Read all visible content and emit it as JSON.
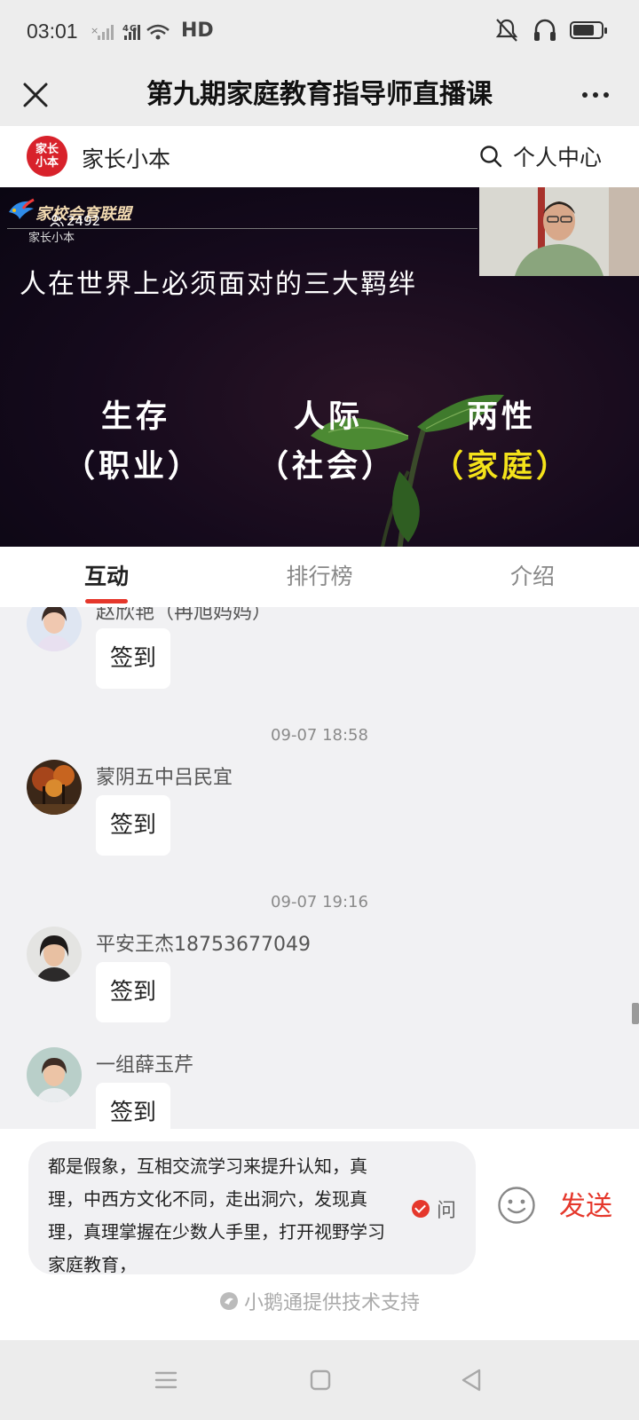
{
  "status_bar": {
    "time": "03:01",
    "network": "4G",
    "wifi_label": "HD",
    "battery_level": 0.75
  },
  "title_bar": {
    "title": "第九期家庭教育指导师直播课"
  },
  "shop": {
    "logo_text": "家长小本",
    "name": "家长小本",
    "personal_center": "个人中心"
  },
  "video": {
    "brand": "家校会育联盟",
    "viewers": "2492",
    "watermark": "家长小本",
    "slide_heading": "人在世界上必须面对的三大羁绊",
    "terms": [
      {
        "title": "生存",
        "sub": "（职业）"
      },
      {
        "title": "人际",
        "sub": "（社会）"
      },
      {
        "title": "两性",
        "sub": "（家庭）"
      }
    ]
  },
  "tabs": [
    {
      "label": "互动",
      "active": true
    },
    {
      "label": "排行榜",
      "active": false
    },
    {
      "label": "介绍",
      "active": false
    }
  ],
  "chat": {
    "messages": [
      {
        "sender": "赵欣艳（冉旭妈妈）",
        "text": "签到"
      },
      {
        "timestamp": "09-07 18:58"
      },
      {
        "sender": "蒙阴五中吕民宜",
        "text": "签到"
      },
      {
        "timestamp": "09-07 19:16"
      },
      {
        "sender": "平安王杰18753677049",
        "text": "签到"
      },
      {
        "sender": "一组薛玉芹",
        "text": "签到"
      }
    ]
  },
  "composer": {
    "input_value": "都是假象，互相交流学习来提升认知，真理，中西方文化不同，走出洞穴，发现真理，真理掌握在少数人手里，打开视野学习家庭教育，",
    "ask_label": "问",
    "send_label": "发送",
    "support_text": "小鹅通提供技术支持"
  },
  "colors": {
    "accent": "#e5372b",
    "highlight_term": "#f4e21a"
  }
}
